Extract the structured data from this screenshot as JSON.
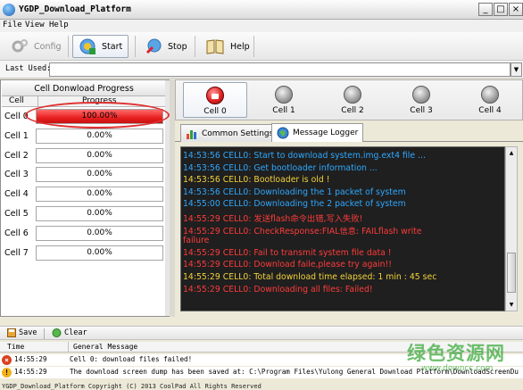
{
  "window": {
    "title": "YGDP_Download_Platform"
  },
  "menu": [
    "File",
    "View",
    "Help"
  ],
  "toolbar": {
    "config": "Config",
    "start": "Start",
    "stop": "Stop",
    "help": "Help"
  },
  "last_used": {
    "label": "Last Used:",
    "value": ""
  },
  "progress_panel": {
    "title": "Cell Donwload Progress",
    "col_cell": "Cell",
    "col_progress": "Progress",
    "rows": [
      {
        "cell": "Cell 0",
        "progress": "100.00%",
        "fraction": 1.0
      },
      {
        "cell": "Cell 1",
        "progress": "0.00%",
        "fraction": 0.0
      },
      {
        "cell": "Cell 2",
        "progress": "0.00%",
        "fraction": 0.0
      },
      {
        "cell": "Cell 3",
        "progress": "0.00%",
        "fraction": 0.0
      },
      {
        "cell": "Cell 4",
        "progress": "0.00%",
        "fraction": 0.0
      },
      {
        "cell": "Cell 5",
        "progress": "0.00%",
        "fraction": 0.0
      },
      {
        "cell": "Cell 6",
        "progress": "0.00%",
        "fraction": 0.0
      },
      {
        "cell": "Cell 7",
        "progress": "0.00%",
        "fraction": 0.0
      }
    ]
  },
  "cells": [
    {
      "label": "Cell 0",
      "status": "red"
    },
    {
      "label": "Cell 1",
      "status": "gray"
    },
    {
      "label": "Cell 2",
      "status": "gray"
    },
    {
      "label": "Cell 3",
      "status": "gray"
    },
    {
      "label": "Cell 4",
      "status": "gray"
    }
  ],
  "tabs": {
    "common": "Common Settings",
    "logger": "Message Logger"
  },
  "log_lines": [
    {
      "text": "14:53:56  CELL0:  Start to download system.img.ext4 file ...",
      "color": "blue"
    },
    {
      "text": "14:53:56  CELL0: Get bootloader information ...",
      "color": "blue"
    },
    {
      "text": "14:53:56  CELL0: Bootloader is old !",
      "color": "yellow"
    },
    {
      "text": "14:53:56  CELL0: Downloading the 1 packet of system",
      "color": "blue"
    },
    {
      "text": "14:55:00  CELL0: Downloading the 2 packet of system",
      "color": "blue"
    },
    {
      "text": "14:55:29  CELL0: 发送flash命令出错,写入失败!",
      "color": "red"
    },
    {
      "text": "14:55:29  CELL0: CheckResponse:FIAL信息: FAILflash write",
      "color": "red"
    },
    {
      "text": "failure",
      "color": "red"
    },
    {
      "text": "14:55:29  CELL0: Fail to transmit system file data !",
      "color": "red"
    },
    {
      "text": "14:55:29  CELL0: Download faile,please try again!!",
      "color": "red"
    },
    {
      "text": "14:55:29  CELL0: Total download time elapsed: 1 min : 45 sec",
      "color": "yellow"
    },
    {
      "text": "14:55:29  CELL0: Downloading all files: Failed!",
      "color": "red"
    }
  ],
  "bottom_toolbar": {
    "save": "Save",
    "clear": "Clear"
  },
  "messages": {
    "col_time": "Time",
    "col_msg": "General Message",
    "rows": [
      {
        "icon": "error",
        "time": "14:55:29",
        "text": "Cell 0: download files failed!"
      },
      {
        "icon": "warning",
        "time": "14:55:29",
        "text": "The download screen dump has been saved at: C:\\Program Files\\Yulong General Download Platform\\DownloadScreenDu"
      }
    ]
  },
  "status_bar": "YGDP_Download_Platform Copyright (C) 2013 CoolPad All Rights Reserved",
  "watermark": {
    "text": "绿色资源网",
    "url": "www.downcc.com"
  },
  "colors": {
    "log_bg": "#1f1f1f",
    "log_blue": "#2ea8ff",
    "log_yellow": "#f2d23b",
    "log_red": "#ff3b3b",
    "progress_red": "#e82020"
  }
}
